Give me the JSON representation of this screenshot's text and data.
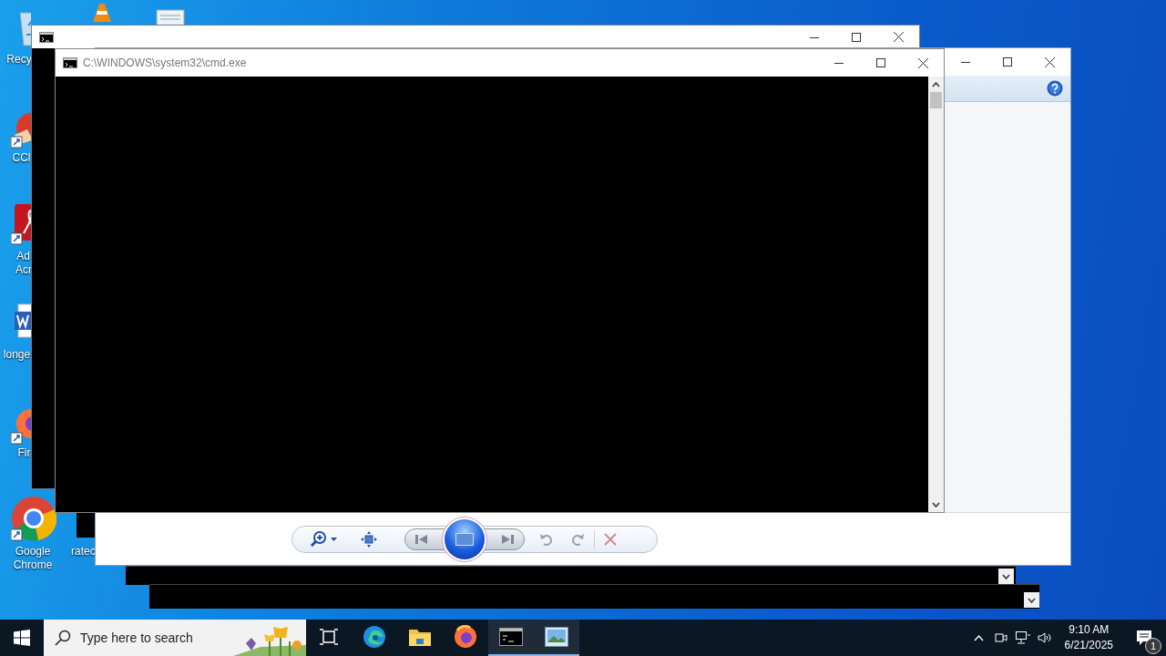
{
  "desktop_icons": [
    {
      "kind": "recycle-bin",
      "lines": [
        "Recy"
      ]
    },
    {
      "kind": "cone"
    },
    {
      "kind": "printer"
    },
    {
      "kind": "cleaner",
      "lines": [
        "CCl"
      ]
    },
    {
      "kind": "acrobat",
      "lines": [
        "Ad",
        "Acr"
      ]
    },
    {
      "kind": "word",
      "lines": [
        "longe"
      ]
    },
    {
      "kind": "firefox",
      "lines": [
        "Fir"
      ]
    },
    {
      "kind": "chrome",
      "lines": [
        "Google",
        "Chrome"
      ]
    },
    {
      "kind": "file",
      "lines": [
        "ratec"
      ]
    }
  ],
  "console_window": {
    "title": "C:\\WINDOWS\\system32\\cmd.exe"
  },
  "taskbar": {
    "search": {
      "placeholder": "Type here to search"
    },
    "apps": [
      {
        "kind": "task-view",
        "active": false
      },
      {
        "kind": "edge",
        "active": false
      },
      {
        "kind": "explorer",
        "active": false
      },
      {
        "kind": "firefox",
        "active": false
      },
      {
        "kind": "console",
        "active": true
      },
      {
        "kind": "photos",
        "active": true
      }
    ],
    "clock": {
      "time": "9:10 AM",
      "date": "6/21/2025"
    },
    "notifications": {
      "count": "1"
    }
  }
}
